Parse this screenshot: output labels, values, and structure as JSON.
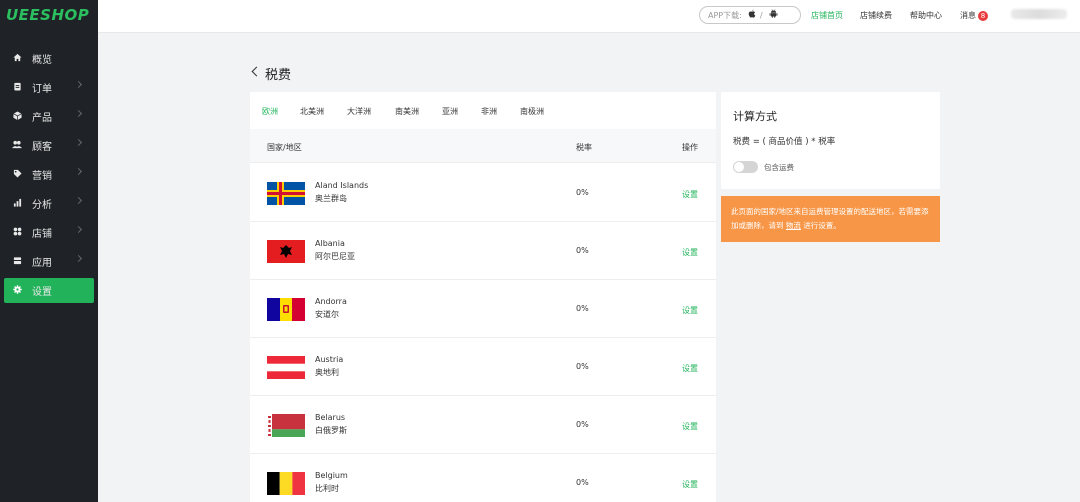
{
  "brand": {
    "logo": "UEESHOP"
  },
  "sidebar": {
    "items": [
      {
        "label": "概览",
        "icon": "home-icon",
        "active": false
      },
      {
        "label": "订单",
        "icon": "clipboard-icon",
        "active": false
      },
      {
        "label": "产品",
        "icon": "box-icon",
        "active": false
      },
      {
        "label": "顾客",
        "icon": "users-icon",
        "active": false
      },
      {
        "label": "营销",
        "icon": "tag-icon",
        "active": false
      },
      {
        "label": "分析",
        "icon": "bar-chart-icon",
        "active": false
      },
      {
        "label": "店铺",
        "icon": "grid-icon",
        "active": false
      },
      {
        "label": "应用",
        "icon": "layers-icon",
        "active": false
      },
      {
        "label": "设置",
        "icon": "gear-icon",
        "active": true
      }
    ]
  },
  "topbar": {
    "app_download": "APP下载:",
    "app_sep": "/",
    "store_home": "店铺首页",
    "renewal": "店铺续费",
    "help": "帮助中心",
    "messages": "消息",
    "message_count": "8"
  },
  "page": {
    "title": "税费"
  },
  "tabs": [
    "欧洲",
    "北美洲",
    "大洋洲",
    "南美洲",
    "亚洲",
    "非洲",
    "南极洲"
  ],
  "table": {
    "headers": {
      "country": "国家/地区",
      "rate": "税率",
      "action": "操作"
    },
    "rows": [
      {
        "name": "Aland Islands",
        "name_zh": "奥兰群岛",
        "rate": "0%",
        "action": "设置",
        "flag": "aland"
      },
      {
        "name": "Albania",
        "name_zh": "阿尔巴尼亚",
        "rate": "0%",
        "action": "设置",
        "flag": "albania"
      },
      {
        "name": "Andorra",
        "name_zh": "安道尔",
        "rate": "0%",
        "action": "设置",
        "flag": "andorra"
      },
      {
        "name": "Austria",
        "name_zh": "奥地利",
        "rate": "0%",
        "action": "设置",
        "flag": "austria"
      },
      {
        "name": "Belarus",
        "name_zh": "白俄罗斯",
        "rate": "0%",
        "action": "设置",
        "flag": "belarus"
      },
      {
        "name": "Belgium",
        "name_zh": "比利时",
        "rate": "0%",
        "action": "设置",
        "flag": "belgium"
      }
    ]
  },
  "calc": {
    "title": "计算方式",
    "formula": "税费 = ( 商品价值 ) * 税率",
    "toggle_label": "包含运费",
    "toggle_on": false
  },
  "notice": {
    "text_before": "此页面的国家/地区来自运费管理设置的配送地区，若需要添加或删除，请到",
    "link": "物流",
    "text_after": "进行设置。"
  },
  "colors": {
    "accent": "#22b35a",
    "sidebar_bg": "#1f2327",
    "notice_bg": "#f79646",
    "badge": "#e83c3c"
  }
}
